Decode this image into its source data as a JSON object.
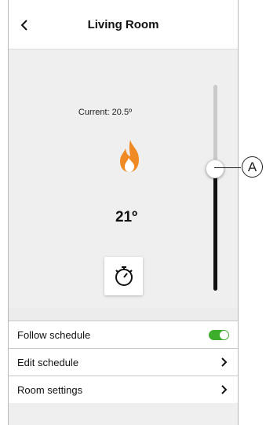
{
  "header": {
    "title": "Living Room",
    "back_icon": "chevron-left-icon"
  },
  "thermostat": {
    "current_label": "Current: 20.5º",
    "setpoint": "21º",
    "flame_color": "#f08a24",
    "timer_icon": "stopwatch-icon",
    "slider_level": 0.62
  },
  "settings": {
    "rows": [
      {
        "label": "Follow schedule",
        "control": "toggle",
        "on": true
      },
      {
        "label": "Edit schedule",
        "control": "chevron"
      },
      {
        "label": "Room settings",
        "control": "chevron"
      }
    ]
  },
  "callout": {
    "label": "A"
  },
  "colors": {
    "toggle_on": "#3dae2b",
    "accent_flame": "#f08a24"
  }
}
